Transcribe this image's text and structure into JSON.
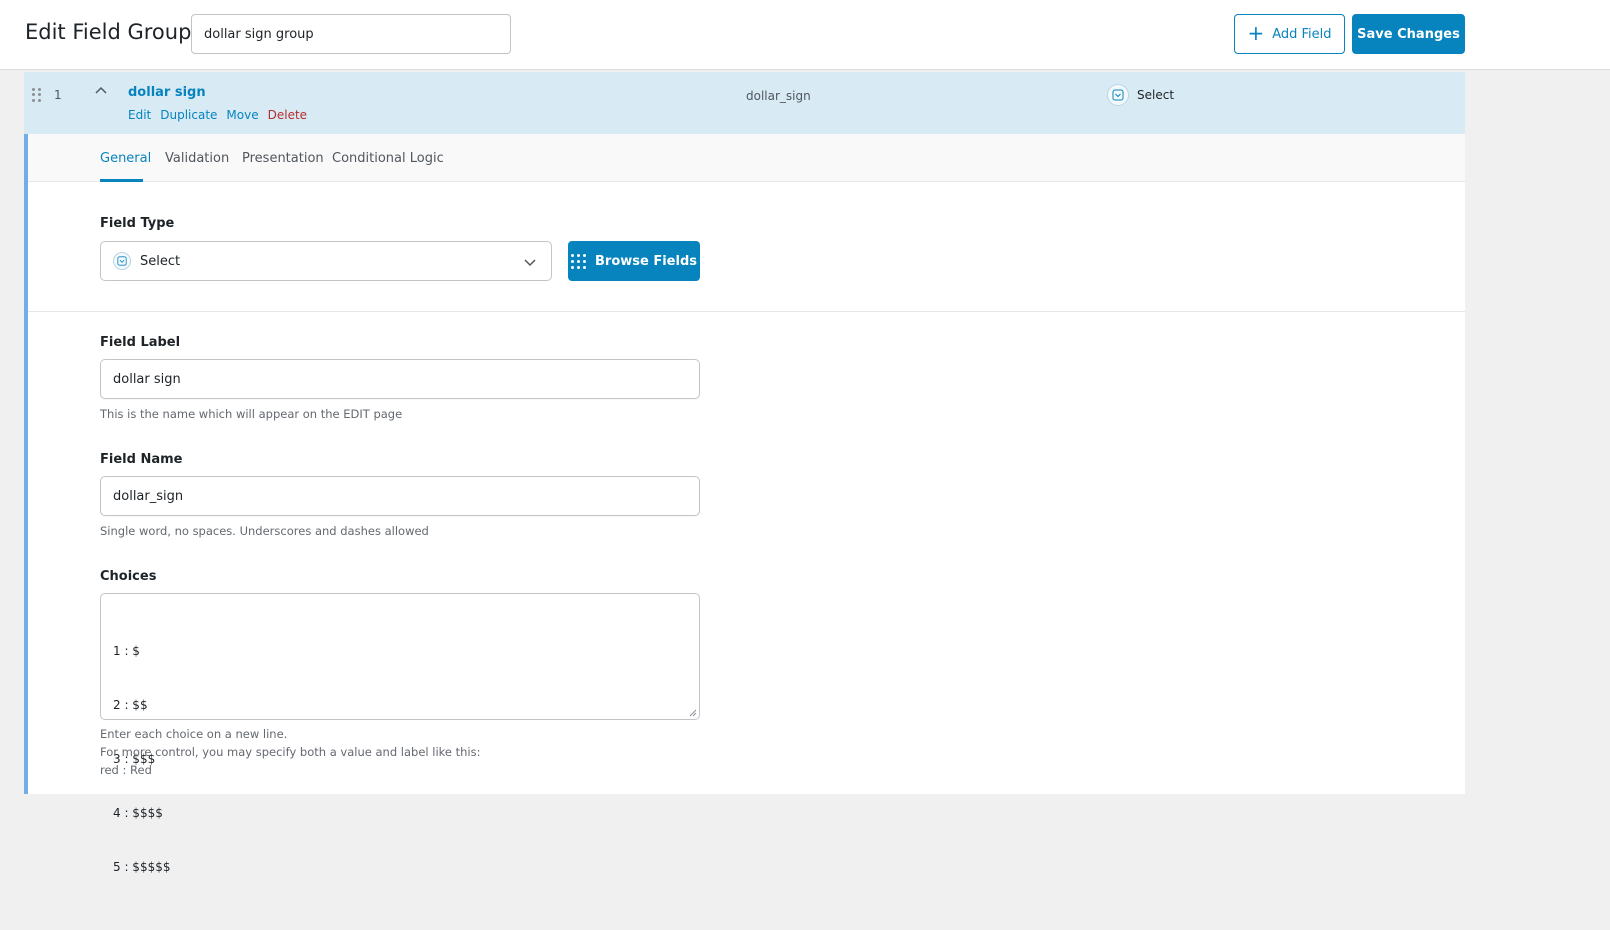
{
  "header": {
    "title": "Edit Field Group",
    "group_title_value": "dollar sign group",
    "add_field_label": "Add Field",
    "save_label": "Save Changes"
  },
  "field": {
    "order": "1",
    "label": "dollar sign",
    "name": "dollar_sign",
    "type": "Select",
    "actions": {
      "edit": "Edit",
      "duplicate": "Duplicate",
      "move": "Move",
      "delete": "Delete"
    }
  },
  "tabs": [
    {
      "label": "General",
      "active": true
    },
    {
      "label": "Validation",
      "active": false
    },
    {
      "label": "Presentation",
      "active": false
    },
    {
      "label": "Conditional Logic",
      "active": false
    }
  ],
  "general": {
    "field_type_label": "Field Type",
    "field_type_value": "Select",
    "browse_fields_label": "Browse Fields",
    "field_label_label": "Field Label",
    "field_label_value": "dollar sign",
    "field_label_help": "This is the name which will appear on the EDIT page",
    "field_name_label": "Field Name",
    "field_name_value": "dollar_sign",
    "field_name_help": "Single word, no spaces. Underscores and dashes allowed",
    "choices_label": "Choices",
    "choices": [
      "1 : $",
      "2 : $$",
      "3 : $$$",
      "4 : $$$$",
      "5 : $$$$$"
    ],
    "choices_help": [
      "Enter each choice on a new line.",
      "For more control, you may specify both a value and label like this:",
      "red : Red"
    ]
  },
  "colors": {
    "accent": "#0783be",
    "row_highlight": "#d8ebf5",
    "delete": "#b32d2e",
    "left_border": "#72aee6"
  }
}
